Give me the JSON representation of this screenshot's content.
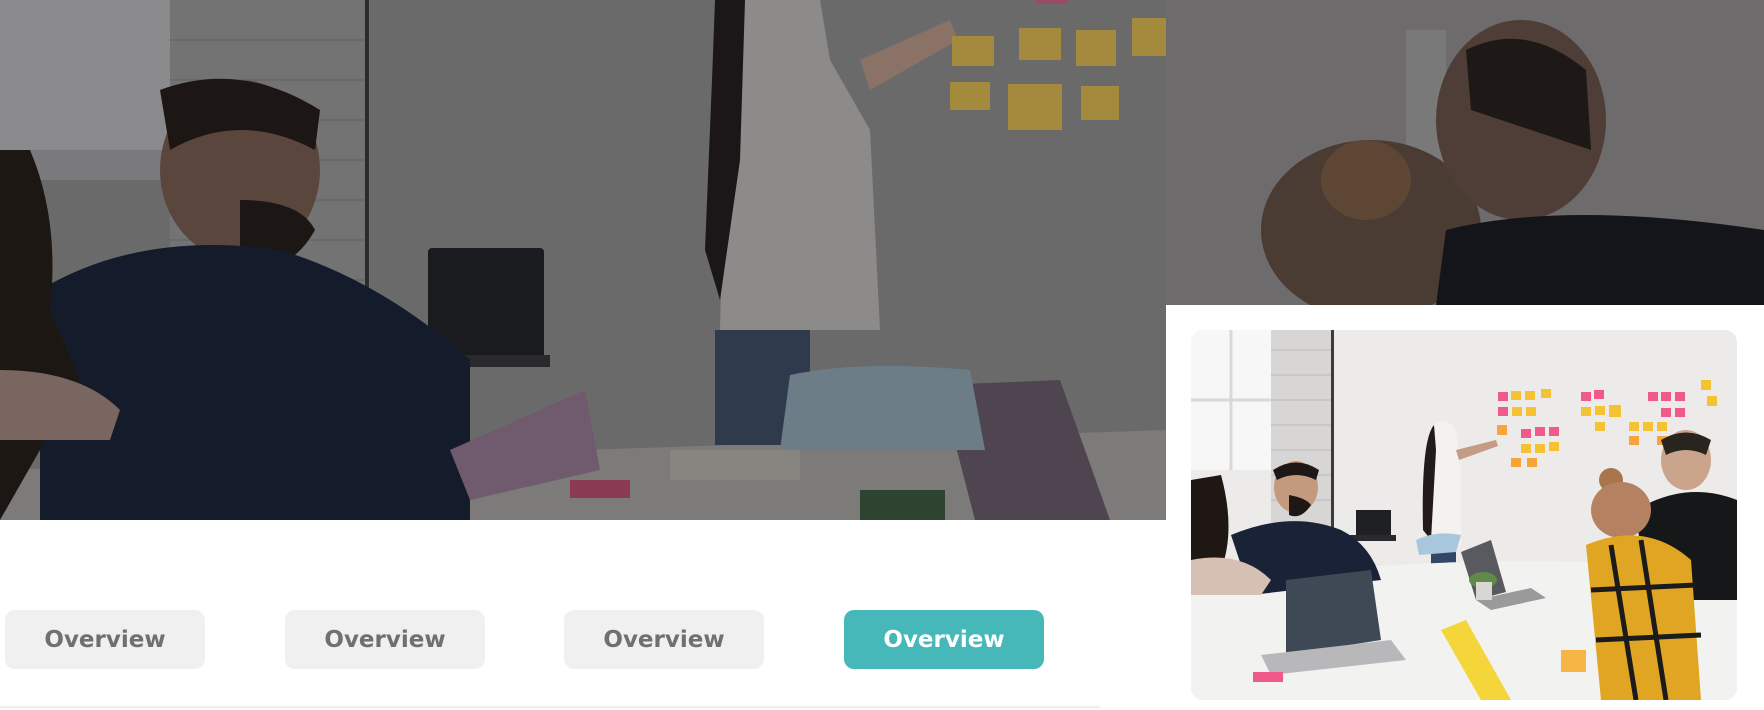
{
  "hero": {
    "image_description_icon": "team-meeting-photo"
  },
  "tabs": [
    {
      "label": "Overview",
      "active": false
    },
    {
      "label": "Overview",
      "active": false
    },
    {
      "label": "Overview",
      "active": false
    },
    {
      "label": "Overview",
      "active": true
    }
  ],
  "colors": {
    "accent": "#46b8ba",
    "tab_inactive_bg": "#f0f0f0",
    "tab_inactive_text": "#707070",
    "tab_active_text": "#ffffff"
  },
  "thumbnail": {
    "icon": "team-meeting-thumbnail"
  }
}
